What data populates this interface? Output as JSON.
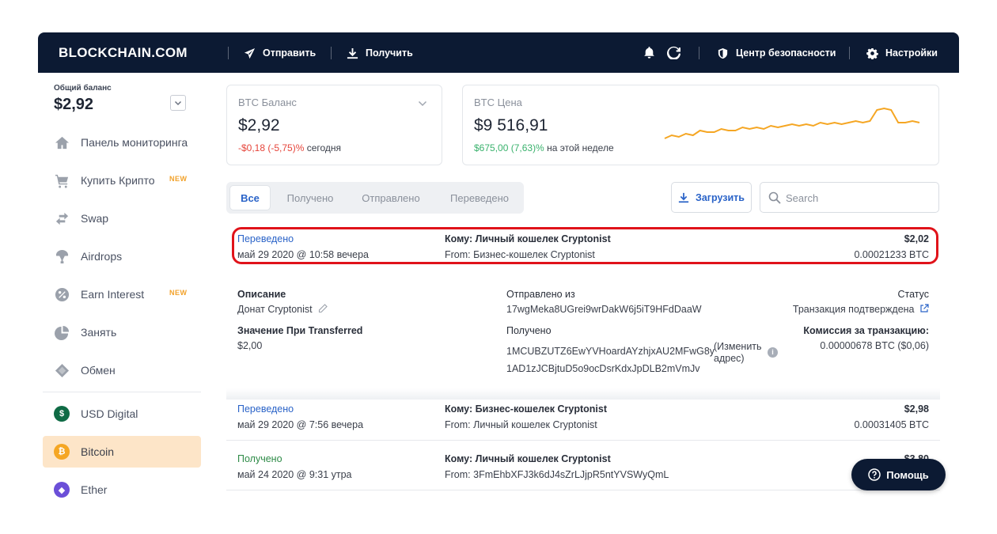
{
  "app": {
    "brand": "BLOCKCHAIN.COM"
  },
  "topbar": {
    "send": "Отправить",
    "receive": "Получить",
    "security": "Центр безопасности",
    "settings": "Настройки"
  },
  "sidebar": {
    "balance_label": "Общий баланс",
    "balance_value": "$2,92",
    "items": [
      {
        "label": "Панель мониторинга",
        "icon": "home-icon"
      },
      {
        "label": "Купить Крипто",
        "icon": "cart-icon",
        "badge": "NEW"
      },
      {
        "label": "Swap",
        "icon": "swap-icon"
      },
      {
        "label": "Airdrops",
        "icon": "airdrop-icon"
      },
      {
        "label": "Earn Interest",
        "icon": "percent-icon",
        "badge": "NEW"
      },
      {
        "label": "Занять",
        "icon": "pie-icon"
      },
      {
        "label": "Обмен",
        "icon": "exchange-icon"
      }
    ],
    "wallets": [
      {
        "label": "USD Digital",
        "icon": "usd-digital-icon",
        "color": "#0f6b45"
      },
      {
        "label": "Bitcoin",
        "icon": "bitcoin-icon",
        "color": "#f5a623"
      },
      {
        "label": "Ether",
        "icon": "ether-icon",
        "color": "#6b4fd8"
      }
    ]
  },
  "btc_balance": {
    "label": "BTC Баланс",
    "value": "$2,92",
    "change": "-$0,18 (-5,75)%",
    "period": "сегодня"
  },
  "btc_price": {
    "label": "BTC Цена",
    "value": "$9 516,91",
    "change": "$675,00 (7,63)%",
    "period": "на этой неделе"
  },
  "sparkline": [
    8,
    10,
    9,
    11,
    10,
    13,
    12,
    12,
    14,
    13,
    13,
    15,
    14,
    15,
    14,
    16,
    15,
    16,
    17,
    16,
    17,
    16,
    18,
    17,
    18,
    17,
    18,
    19,
    18,
    19,
    26,
    27,
    26,
    18,
    18,
    19,
    18
  ],
  "tabs": [
    "Все",
    "Получено",
    "Отправлено",
    "Переведено"
  ],
  "download_label": "Загрузить",
  "search_placeholder": "Search",
  "transactions": [
    {
      "type": "Переведено",
      "date": "май 29 2020 @ 10:58 вечера",
      "to_label": "Кому:",
      "to": "Личный кошелек Cryptonist",
      "from_label": "From:",
      "from": "Бизнес-кошелек Cryptonist",
      "usd": "$2,02",
      "btc": "0.00021233 BTC"
    },
    {
      "type": "Переведено",
      "date": "май 29 2020 @ 7:56 вечера",
      "to_label": "Кому:",
      "to": "Бизнес-кошелек Cryptonist",
      "from_label": "From:",
      "from": "Личный кошелек Cryptonist",
      "usd": "$2,98",
      "btc": "0.00031405 BTC"
    },
    {
      "type": "Получено",
      "date": "май 24 2020 @ 9:31 утра",
      "to_label": "Кому:",
      "to": "Личный кошелек Cryptonist",
      "from_label": "From:",
      "from": "3FmEhbXFJ3k6dJ4sZrLJjpR5ntYVSWyQmL",
      "usd": "$3,80",
      "btc": ""
    }
  ],
  "detail": {
    "description_label": "Описание",
    "description": "Донат Cryptonist",
    "value_label": "Значение При Transferred",
    "value": "$2,00",
    "sent_from_label": "Отправлено из",
    "sent_from": "17wgMeka8UGrei9wrDakW6j5iT9HFdDaaW",
    "received_label": "Получено",
    "received_1": "1MCUBZUTZ6EwYVHoardAYzhjxAU2MFwG8y",
    "received_2": "1AD1zJCBjtuD5o9ocDsrKdxJpDLB2mVmJv",
    "change_address": "(Изменить адрес)",
    "status_label": "Статус",
    "status": "Транзакция подтверждена",
    "fee_label": "Комиссия за транзакцию:",
    "fee": "0.00000678 BTC ($0,06)"
  },
  "help_label": "Помощь"
}
